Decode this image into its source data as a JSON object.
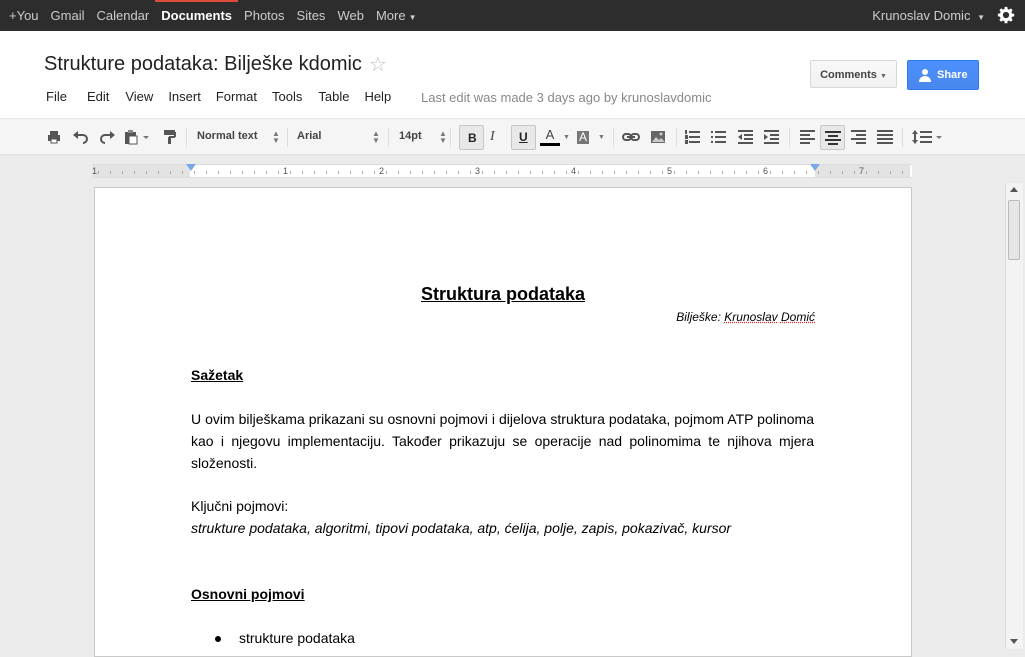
{
  "topbar": {
    "links": [
      "+You",
      "Gmail",
      "Calendar",
      "Documents",
      "Photos",
      "Sites",
      "Web",
      "More"
    ],
    "active": "Documents",
    "user": "Krunoslav Domic"
  },
  "header": {
    "doc_title": "Strukture podataka: Bilješke kdomic",
    "menu": [
      "File",
      "Edit",
      "View",
      "Insert",
      "Format",
      "Tools",
      "Table",
      "Help"
    ],
    "last_edit": "Last edit was made 3 days ago by krunoslavdomic",
    "comments_label": "Comments",
    "share_label": "Share"
  },
  "toolbar": {
    "style": "Normal text",
    "font": "Arial",
    "size": "14pt",
    "bold": "B",
    "italic": "I",
    "underline": "U",
    "text_color_letter": "A",
    "highlight_letter": "A"
  },
  "ruler": {
    "numbers": [
      "1",
      "1",
      "2",
      "3",
      "4",
      "5",
      "6",
      "7"
    ]
  },
  "document": {
    "title": "Struktura podataka",
    "byline_prefix": "Bilješke: ",
    "byline_first": "Krunoslav",
    "byline_last": "Domić",
    "section1": "Sažetak",
    "abstract": "U ovim bilješkama prikazani su osnovni pojmovi i dijelova struktura podataka, pojmom ATP polinoma kao i njegovu implementaciju. Također prikazuju se operacije nad polinomima te njihova mjera složenosti.",
    "keywords_label": "Ključni pojmovi:",
    "keywords": "strukture podataka, algoritmi, tipovi podataka, atp, ćelija, polje, zapis, pokazivač, kursor",
    "section2": "Osnovni pojmovi",
    "bullet1": "strukture podataka"
  },
  "colors": {
    "topbar_bg": "#2d2d2d",
    "share_blue": "#4d90fe",
    "active_red": "#dd4b39"
  }
}
